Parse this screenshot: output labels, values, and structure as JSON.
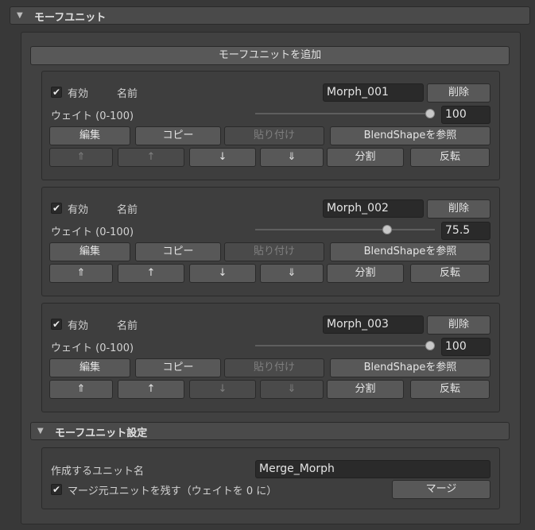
{
  "foldout_title": "モーフユニット",
  "add_button": "モーフユニットを追加",
  "units": [
    {
      "enabled_label": "有効",
      "enabled": true,
      "name_label": "名前",
      "name": "Morph_001",
      "delete": "削除",
      "weight_label": "ウェイト (0-100)",
      "weight": "100",
      "weight_fraction": 1.0,
      "buttons_row1": [
        "編集",
        "コピー",
        "貼り付け",
        "BlendShapeを参照"
      ],
      "buttons_row2": [
        "⇑",
        "↑",
        "↓",
        "⇓",
        "分割",
        "反転"
      ],
      "row2_disabled": [
        true,
        true,
        false,
        false,
        false,
        false
      ]
    },
    {
      "enabled_label": "有効",
      "enabled": true,
      "name_label": "名前",
      "name": "Morph_002",
      "delete": "削除",
      "weight_label": "ウェイト (0-100)",
      "weight": "75.5",
      "weight_fraction": 0.755,
      "buttons_row1": [
        "編集",
        "コピー",
        "貼り付け",
        "BlendShapeを参照"
      ],
      "buttons_row2": [
        "⇑",
        "↑",
        "↓",
        "⇓",
        "分割",
        "反転"
      ],
      "row2_disabled": [
        false,
        false,
        false,
        false,
        false,
        false
      ]
    },
    {
      "enabled_label": "有効",
      "enabled": true,
      "name_label": "名前",
      "name": "Morph_003",
      "delete": "削除",
      "weight_label": "ウェイト (0-100)",
      "weight": "100",
      "weight_fraction": 1.0,
      "buttons_row1": [
        "編集",
        "コピー",
        "貼り付け",
        "BlendShapeを参照"
      ],
      "buttons_row2": [
        "⇑",
        "↑",
        "↓",
        "⇓",
        "分割",
        "反転"
      ],
      "row2_disabled": [
        false,
        false,
        true,
        true,
        false,
        false
      ]
    }
  ],
  "settings": {
    "title": "モーフユニット設定",
    "unit_name_label": "作成するユニット名",
    "unit_name": "Merge_Morph",
    "keep_label": "マージ元ユニットを残す（ウェイトを 0 に）",
    "keep": true,
    "merge_button": "マージ"
  }
}
